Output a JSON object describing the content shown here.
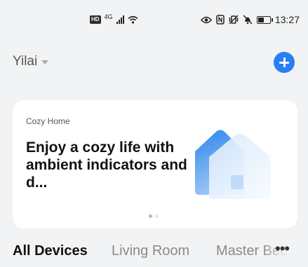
{
  "status_bar": {
    "hd_badge": "HD",
    "signal_label": "4G",
    "time": "13:27",
    "icons": [
      "hd-icon",
      "signal-icon",
      "wifi-icon",
      "eye-icon",
      "nfc-icon",
      "vibrate-icon",
      "mute-icon",
      "battery-icon"
    ]
  },
  "header": {
    "home_name": "Yilai",
    "add_button_icon": "plus-icon",
    "accent_color": "#2a7ef5"
  },
  "banner": {
    "eyebrow": "Cozy Home",
    "title": "Enjoy a cozy life with ambient indicators and d...",
    "illustration": "house-icon",
    "dots_total": 2,
    "active_dot": 1
  },
  "tabs": {
    "items": [
      {
        "label": "All Devices",
        "active": true
      },
      {
        "label": "Living Room",
        "active": false
      },
      {
        "label": "Master Bedroom",
        "active": false
      }
    ],
    "more_label": "•••"
  }
}
